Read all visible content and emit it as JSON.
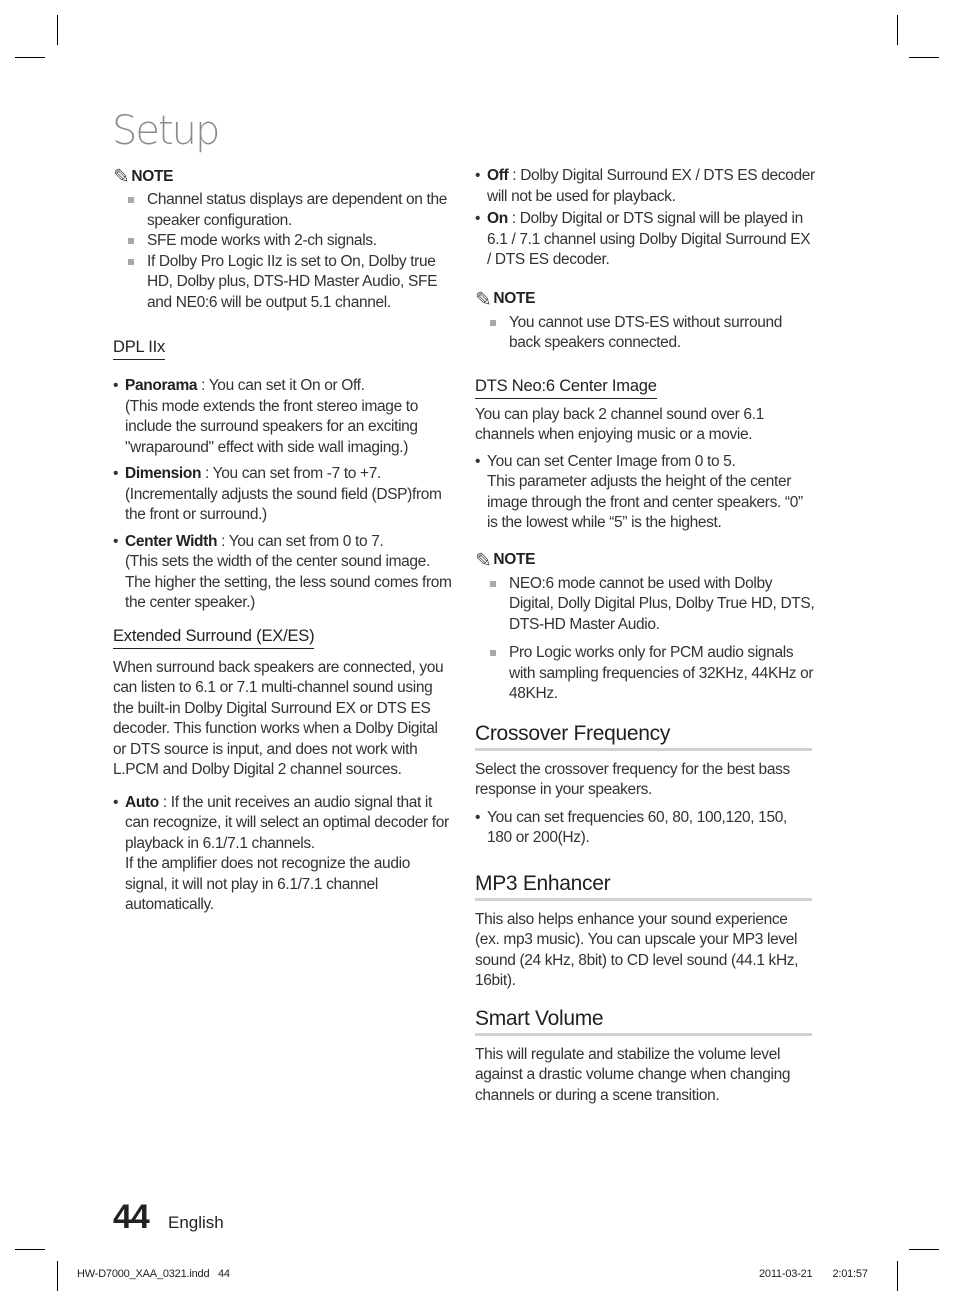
{
  "page": {
    "title": "Setup",
    "page_number": "44",
    "language": "English",
    "slug_file": "HW-D7000_XAA_0321.indd   44",
    "slug_date": "2011-03-21",
    "slug_time": "2:01:57"
  },
  "icons": {
    "note": "pencil-icon",
    "note_bullet": "square-bullet",
    "list_bullet": "round-bullet"
  },
  "colors": {
    "title": "#8a8a8a",
    "body_text": "#333333",
    "major_heading_rule": "#d0d0d0",
    "note_bullet": "#a8a8a8"
  },
  "left": {
    "note1": {
      "label": "NOTE",
      "items": [
        "Channel status displays are dependent on the speaker configuration.",
        "SFE mode works with 2-ch signals.",
        "If Dolby Pro Logic IIz is set to On, Dolby true HD, Dolby plus, DTS-HD Master Audio, SFE and NE0:6 will be output 5.1 channel."
      ]
    },
    "dpl": {
      "heading": "DPL IIx",
      "items": [
        {
          "term": "Panorama",
          "text": " : You can set it On or Off.",
          "detail": "(This mode extends the front stereo image to include the surround speakers for an exciting \"wraparound\" effect with side wall imaging.)"
        },
        {
          "term": "Dimension",
          "text": " : You can set from -7 to +7.",
          "detail": "(Incrementally adjusts the sound field (DSP)from the front or surround.)"
        },
        {
          "term": "Center Width",
          "text": " : You can set from 0 to 7.",
          "detail": "(This sets the width of the center sound image. The higher the setting, the less sound comes from the center speaker.)"
        }
      ]
    },
    "extended": {
      "heading": "Extended Surround (EX/ES)",
      "paragraph": "When surround back speakers are connected, you can listen to 6.1 or 7.1 multi-channel sound using the built-in Dolby Digital Surround EX or DTS ES decoder. This function works when a Dolby Digital or DTS source is input, and does not work with L.PCM and Dolby Digital 2 channel sources.",
      "items": [
        {
          "term": "Auto",
          "text": " : If the unit receives an audio signal that it can recognize, it will select an optimal decoder for playback in 6.1/7.1 channels.",
          "detail": "If the amplifier does not recognize the audio signal, it will not play in 6.1/7.1 channel automatically."
        }
      ]
    }
  },
  "right": {
    "extended_cont": {
      "items": [
        {
          "term": "Off",
          "text": " : Dolby Digital Surround EX / DTS ES decoder will not be used for playback."
        },
        {
          "term": "On",
          "text": " : Dolby Digital or DTS signal will be played in 6.1 / 7.1 channel using Dolby Digital Surround EX / DTS ES decoder."
        }
      ]
    },
    "note2": {
      "label": "NOTE",
      "items": [
        "You cannot use DTS-ES without surround back speakers connected."
      ]
    },
    "neo6": {
      "heading": "DTS Neo:6 Center Image",
      "paragraph": "You can play back 2 channel sound over 6.1 channels when enjoying music or a movie.",
      "bullet": "You can set Center Image from 0 to 5.",
      "detail": "This parameter adjusts the height of the center image through the front and center speakers. “0” is the lowest while “5” is the highest."
    },
    "note3": {
      "label": "NOTE",
      "items": [
        "NEO:6 mode cannot be used with  Dolby Digital, Dolly Digital Plus, Dolby True HD, DTS, DTS-HD Master Audio.",
        "Pro Logic works only for PCM audio signals with sampling frequencies of 32KHz, 44KHz or 48KHz."
      ]
    },
    "crossover": {
      "heading": "Crossover Frequency",
      "paragraph": "Select the crossover frequency for the best bass response in your speakers.",
      "bullet": "You can set frequencies 60, 80, 100,120, 150, 180 or 200(Hz)."
    },
    "mp3": {
      "heading": "MP3 Enhancer",
      "paragraph": "This also helps enhance your sound experience (ex. mp3 music). You can upscale your MP3 level sound (24 kHz, 8bit) to CD level sound (44.1 kHz, 16bit)."
    },
    "smart_volume": {
      "heading": "Smart Volume",
      "paragraph": "This will regulate and stabilize the volume level against a drastic volume change when changing channels or during a scene transition."
    }
  }
}
